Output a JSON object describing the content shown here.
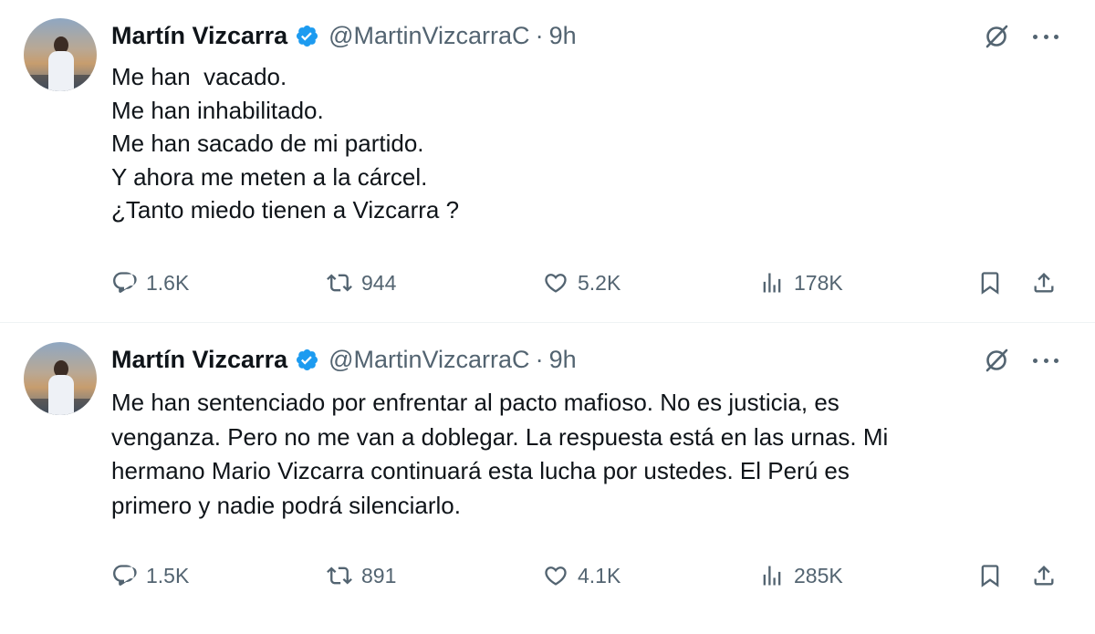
{
  "colors": {
    "text_primary": "#0f1419",
    "text_secondary": "#536471",
    "verified_blue": "#1d9bf0",
    "divider": "#eff3f4"
  },
  "tweets": [
    {
      "author": {
        "name": "Martín Vizcarra",
        "handle": "@MartinVizcarraC",
        "verified": true
      },
      "separator": "·",
      "time": "9h",
      "text": "Me han  vacado.\nMe han inhabilitado.\nMe han sacado de mi partido.\nY ahora me meten a la cárcel.\n¿Tanto miedo tienen a Vizcarra ?",
      "stats": {
        "replies": "1.6K",
        "reposts": "944",
        "likes": "5.2K",
        "views": "178K"
      }
    },
    {
      "author": {
        "name": "Martín Vizcarra",
        "handle": "@MartinVizcarraC",
        "verified": true
      },
      "separator": "·",
      "time": "9h",
      "text": "Me han sentenciado por enfrentar al pacto mafioso. No es justicia, es\nvenganza. Pero no me van a doblegar. La respuesta está en las urnas. Mi\nhermano Mario Vizcarra continuará esta lucha por ustedes. El Perú es\nprimero y nadie podrá silenciarlo.",
      "stats": {
        "replies": "1.5K",
        "reposts": "891",
        "likes": "4.1K",
        "views": "285K"
      }
    }
  ],
  "icons": {
    "verified": "verified-badge-icon",
    "grok": "grok-icon",
    "more": "more-options-icon",
    "reply": "reply-icon",
    "repost": "repost-icon",
    "like": "heart-icon",
    "views": "views-chart-icon",
    "bookmark": "bookmark-icon",
    "share": "share-icon"
  }
}
